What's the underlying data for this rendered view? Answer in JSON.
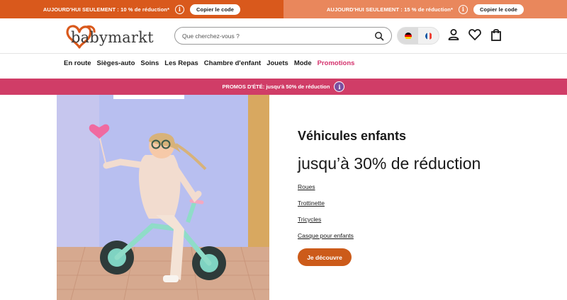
{
  "promo_bar": {
    "left": {
      "text": "AUJOURD'HUI SEULEMENT : 10 % de réduction*",
      "button": "Copier le code",
      "color": "#d9591c"
    },
    "right": {
      "text": "AUJOURD'HUI SEULEMENT : 15 % de réduction*",
      "button": "Copier le code",
      "color": "#e9875c"
    }
  },
  "header": {
    "logo_text": "babymarkt",
    "search_placeholder": "Que cherchez-vous ?",
    "languages": [
      "de",
      "fr"
    ],
    "icons": [
      "account-icon",
      "heart-icon",
      "shopping-bag-icon"
    ]
  },
  "nav": {
    "items": [
      "En route",
      "Sièges-auto",
      "Soins",
      "Les Repas",
      "Chambre d'enfant",
      "Jouets",
      "Mode"
    ],
    "promo_item": "Promotions",
    "promo_color": "#d4326d"
  },
  "summer_banner": {
    "text": "PROMOS D'ÉTÉ: jusqu'à 50% de réduction",
    "color": "#d03d67"
  },
  "hero": {
    "headline": "Véhicules enfants",
    "subhead": "jusqu’à 30% de réduction",
    "links": [
      "Roues",
      "Trottinette",
      "Tricycles",
      "Casque pour enfants"
    ],
    "cta": "Je découvre",
    "cta_color": "#cc5b1a"
  }
}
